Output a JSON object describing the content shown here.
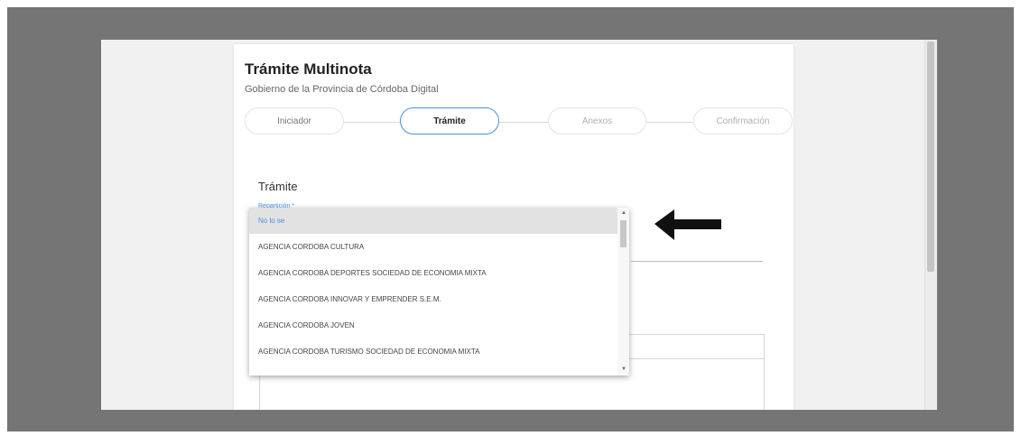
{
  "header": {
    "title": "Trámite Multinota",
    "subtitle": "Gobierno de la Provincia de Córdoba Digital"
  },
  "stepper": {
    "steps": [
      {
        "label": "Iniciador"
      },
      {
        "label": "Trámite"
      },
      {
        "label": "Anexos"
      },
      {
        "label": "Confirmación"
      }
    ],
    "active_index": 1
  },
  "form": {
    "section_title": "Trámite",
    "field_label": "Repartición *"
  },
  "dropdown": {
    "selected": "No lo se",
    "options": [
      "No lo se",
      "AGENCIA CORDOBA CULTURA",
      "AGENCIA CORDOBA DEPORTES SOCIEDAD DE ECONOMIA MIXTA",
      "AGENCIA CORDOBA INNOVAR Y EMPRENDER S.E.M.",
      "AGENCIA CORDOBA JOVEN",
      "AGENCIA CORDOBA TURISMO SOCIEDAD DE ECONOMIA MIXTA"
    ]
  },
  "colors": {
    "accent": "#4a90e2",
    "frame": "#757575",
    "arrow": "#111111"
  },
  "icons": {
    "annotation": "left-arrow-icon",
    "scroll_up": "chevron-up-icon",
    "scroll_down": "chevron-down-icon"
  }
}
